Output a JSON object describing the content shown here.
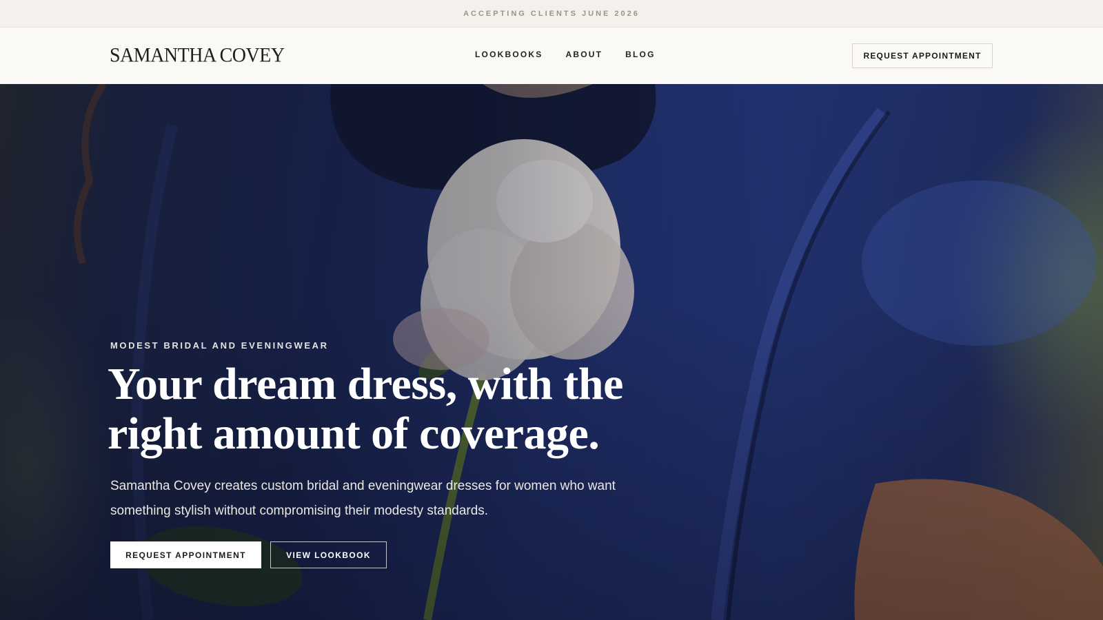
{
  "announcement": {
    "text": "ACCEPTING CLIENTS JUNE 2026"
  },
  "header": {
    "logo": "SAMANTHA COVEY",
    "nav": [
      "LOOKBOOKS",
      "ABOUT",
      "BLOG"
    ],
    "cta": "REQUEST APPOINTMENT"
  },
  "hero": {
    "image": "woman-in-navy-satin-dress-holding-white-rose-photo",
    "eyebrow": "MODEST BRIDAL AND EVENINGWEAR",
    "headline_line1": "Your dream dress, with the",
    "headline_line2": "right amount of coverage.",
    "lede": "Samantha Covey creates custom bridal and eveningwear dresses for women who want something stylish without compromising their modesty standards.",
    "primary_cta": "REQUEST APPOINTMENT",
    "secondary_cta": "VIEW LOOKBOOK"
  },
  "colors": {
    "announcement_bg": "#f4f1ec",
    "header_bg": "#faf9f6",
    "dress_navy": "#1f2d64",
    "text_dark": "#1e1e1e",
    "text_light": "#ffffff"
  }
}
